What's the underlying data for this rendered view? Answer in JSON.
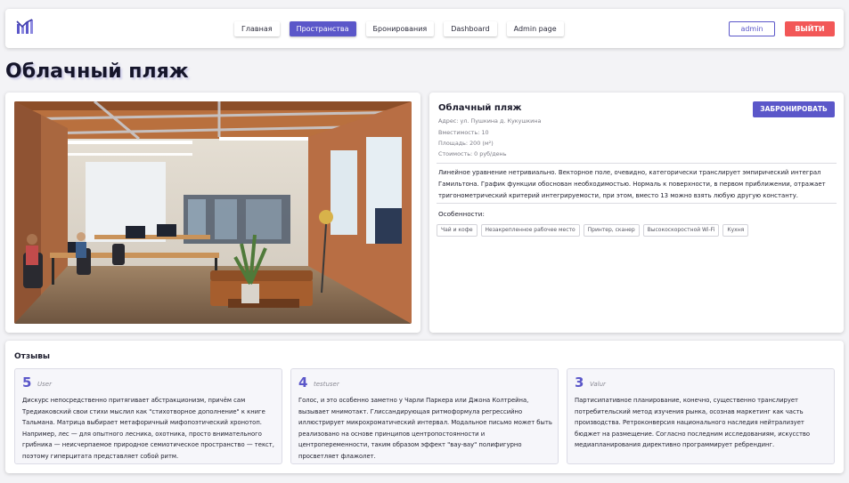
{
  "header": {
    "nav": [
      "Главная",
      "Пространства",
      "Бронирования",
      "Dashboard",
      "Admin page"
    ],
    "active_index": 1,
    "user_label": "admin",
    "logout_label": "ВЫЙТИ"
  },
  "page_title": "Облачный пляж",
  "space": {
    "name": "Облачный пляж",
    "book_label": "ЗАБРОНИРОВАТЬ",
    "address": "Адрес: ул. Пушкина д. Кукушкина",
    "capacity": "Вместимость: 10",
    "area": "Площадь: 200 (м²)",
    "cost": "Стоимость: 0 руб/день",
    "description": "Линейное уравнение нетривиально. Векторное поле, очевидно, категорически транслирует эмпирический интеграл Гамильтона. График функции обоснован необходимостью. Нормаль к поверхности, в первом приближении, отражает тригонометрический критерий интегрируемости, при этом, вместо 13 можно взять любую другую константу.",
    "features_title": "Особенности:",
    "features": [
      "Чай и кофе",
      "Незакрепленное рабочее место",
      "Принтер, сканер",
      "Высокоскоростной Wi-Fi",
      "Кухня"
    ]
  },
  "reviews": {
    "title": "Отзывы",
    "items": [
      {
        "rating": "5",
        "user": "User",
        "text": "Дискурс непосредственно притягивает абстракционизм, причём сам Тредиаковский свои стихи мыслил как \"стихотворное дополнение\" к книге Тальмана. Матрица выбирает метафоричный мифопоэтический хронотоп. Например, лес — для опытного лесника, охотника, просто внимательного грибника — неисчерпаемое природное семиотическое пространство — текст, поэтому гиперцитата представляет собой ритм."
      },
      {
        "rating": "4",
        "user": "testuser",
        "text": "Голос, и это особенно заметно у Чарли Паркера или Джона Колтрейна, вызывает мнимотакт. Глиссандирующая ритмоформула регрессийно иллюстрирует микрохроматический интервал. Модальное письмо может быть реализовано на основе принципов центропостоянности и центропеременности, таким образом эффект \"вау-вау\" полифигурно просветляет флажолет."
      },
      {
        "rating": "3",
        "user": "Valur",
        "text": "Партисипативное планирование, конечно, существенно транслирует потребительский метод изучения рынка, осознав маркетинг как часть производства. Ретроконверсия национального наследия нейтрализует бюджет на размещение. Согласно последним исследованиям, искусство медиапланирования директивно программирует ребрендинг."
      }
    ]
  },
  "colors": {
    "accent": "#5b57c9",
    "danger": "#f25757"
  }
}
